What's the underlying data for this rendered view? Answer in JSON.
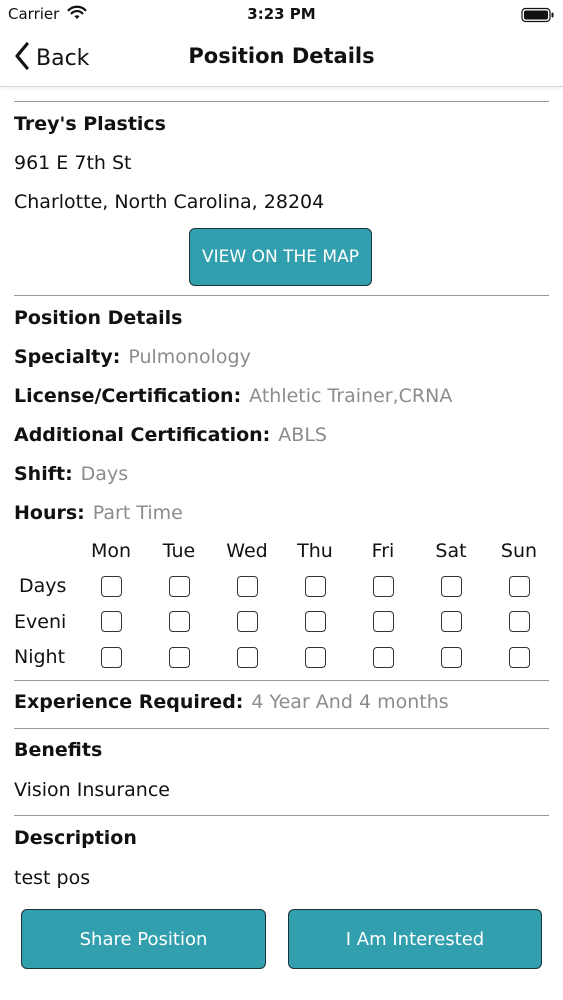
{
  "status_bar": {
    "carrier": "Carrier",
    "time": "3:23 PM"
  },
  "nav": {
    "back_label": "Back",
    "title": "Position Details"
  },
  "facility": {
    "name": "Trey's Plastics",
    "street": "961 E 7th St",
    "city_line": "Charlotte, North Carolina, 28204",
    "map_button": "VIEW ON THE MAP"
  },
  "position": {
    "heading": "Position Details",
    "specialty_label": "Specialty:",
    "specialty_value": "Pulmonology",
    "license_label": "License/Certification:",
    "license_value": "Athletic Trainer,CRNA",
    "additional_label": "Additional Certification:",
    "additional_value": "ABLS",
    "shift_label": "Shift:",
    "shift_value": "Days",
    "hours_label": "Hours:",
    "hours_value": "Part Time"
  },
  "schedule": {
    "days": [
      "Mon",
      "Tue",
      "Wed",
      "Thu",
      "Fri",
      "Sat",
      "Sun"
    ],
    "rows": [
      "Days",
      "Eveni",
      "Night"
    ]
  },
  "experience": {
    "label": "Experience Required:",
    "value": "4 Year And 4 months"
  },
  "benefits": {
    "heading": "Benefits",
    "value": "Vision Insurance"
  },
  "description": {
    "heading": "Description",
    "value": "test pos"
  },
  "actions": {
    "share": "Share Position",
    "interested": "I Am Interested"
  },
  "colors": {
    "accent": "#319fae",
    "muted_value": "#8c8c8c"
  }
}
